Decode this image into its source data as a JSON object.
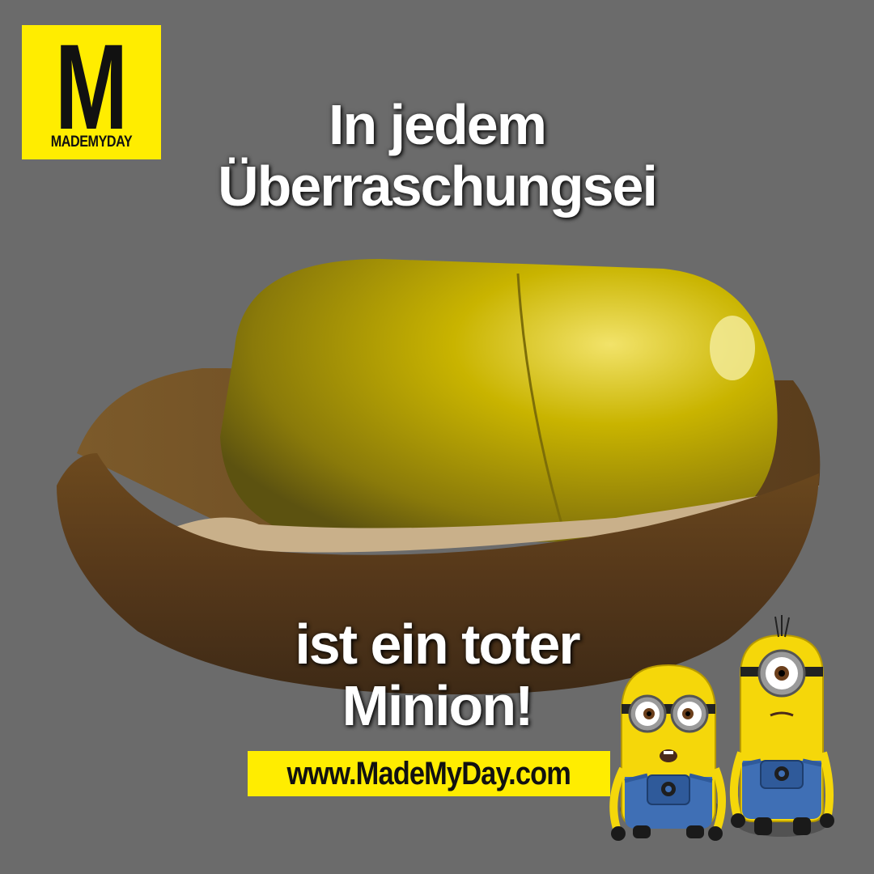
{
  "logo": {
    "letter": "M",
    "subtitle": "MADEMYDAY",
    "background": "#ffed00"
  },
  "headline_top": {
    "line1": "In jedem",
    "line2": "Überraschungsei"
  },
  "headline_bottom": {
    "line1": "ist ein toter",
    "line2": "Minion!"
  },
  "url": "www.MadeMyDay.com",
  "colors": {
    "background": "#6b6b6b",
    "brand_yellow": "#ffed00",
    "text": "#ffffff"
  }
}
